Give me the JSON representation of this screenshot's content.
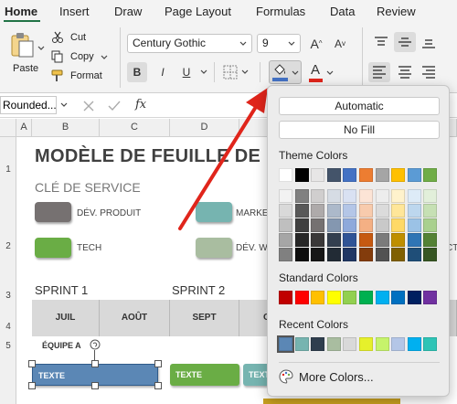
{
  "ribbon_tabs": [
    "Home",
    "Insert",
    "Draw",
    "Page Layout",
    "Formulas",
    "Data",
    "Review"
  ],
  "clipboard": {
    "paste_label": "Paste",
    "cut_label": "Cut",
    "copy_label": "Copy",
    "format_label": "Format"
  },
  "font": {
    "name": "Century Gothic",
    "size": "9",
    "bold": "B",
    "italic": "I",
    "underline": "U",
    "font_color_glyph": "A"
  },
  "formula_bar": {
    "name_box": "Rounded...",
    "fx": "fx"
  },
  "columns": [
    "A",
    "B",
    "C",
    "D"
  ],
  "rows": [
    "1",
    "2",
    "3",
    "4",
    "5"
  ],
  "sheet": {
    "title": "MODÈLE DE FEUILLE DE RO",
    "subtitle": "CLÉ DE SERVICE",
    "legend": [
      {
        "label": "DÉV. PRODUIT",
        "color": "#767171"
      },
      {
        "label": "MARKE",
        "color": "#76b4b0"
      },
      {
        "label": "TECH",
        "color": "#6aad45"
      },
      {
        "label": "DÉV. W",
        "color": "#a9bda0"
      }
    ],
    "legend_cut": "CT",
    "sprints": [
      "SPRINT 1",
      "SPRINT 2"
    ],
    "months": [
      "JUIL",
      "AOÛT",
      "SEPT",
      "O"
    ],
    "team_label": "ÉQUIPE A",
    "tasks": [
      {
        "label": "TEXTE",
        "color": "#5b87b5"
      },
      {
        "label": "TEXTE",
        "color": "#6aad45"
      },
      {
        "label": "TEXTE",
        "color": "#76b4b0"
      }
    ]
  },
  "fill_menu": {
    "automatic_label": "Automatic",
    "no_fill_label": "No Fill",
    "theme_header": "Theme Colors",
    "theme_base": [
      "#ffffff",
      "#000000",
      "#e7e6e6",
      "#44546a",
      "#4472c4",
      "#ed7d31",
      "#a5a5a5",
      "#ffc000",
      "#5b9bd5",
      "#70ad47"
    ],
    "theme_shades": [
      [
        "#f2f2f2",
        "#808080",
        "#d0cece",
        "#d6dce4",
        "#d9e1f2",
        "#fce4d6",
        "#ededed",
        "#fff2cc",
        "#ddebf7",
        "#e2efda"
      ],
      [
        "#d9d9d9",
        "#595959",
        "#aeaaaa",
        "#acb9ca",
        "#b4c6e7",
        "#f8cbad",
        "#dbdbdb",
        "#ffe699",
        "#bdd7ee",
        "#c6e0b4"
      ],
      [
        "#bfbfbf",
        "#404040",
        "#757171",
        "#8497b0",
        "#8ea9db",
        "#f4b084",
        "#c9c9c9",
        "#ffd966",
        "#9bc2e6",
        "#a9d08e"
      ],
      [
        "#a6a6a6",
        "#262626",
        "#3a3838",
        "#333f4f",
        "#305496",
        "#c65911",
        "#7b7b7b",
        "#bf8f00",
        "#2f75b5",
        "#548235"
      ],
      [
        "#808080",
        "#0d0d0d",
        "#161616",
        "#222b35",
        "#203764",
        "#833c0c",
        "#525252",
        "#806000",
        "#1f4e78",
        "#375623"
      ]
    ],
    "standard_header": "Standard Colors",
    "standard": [
      "#c00000",
      "#ff0000",
      "#ffc000",
      "#ffff00",
      "#92d050",
      "#00b050",
      "#00b0f0",
      "#0070c0",
      "#002060",
      "#7030a0"
    ],
    "recent_header": "Recent Colors",
    "recent": [
      "#5b87b5",
      "#76b4b0",
      "#2f3e4e",
      "#a9bda0",
      "#d9d9d9",
      "#e6f02b",
      "#c6f36b",
      "#b4c6e7",
      "#00b0f0",
      "#2ec4b6"
    ],
    "more_label": "More Colors..."
  },
  "colors": {
    "accent": "#217346",
    "arrow": "#e0251b",
    "fill_bar": "#4472c4",
    "font_bar": "#e0251b"
  },
  "icons": [
    "paste-icon",
    "scissors-icon",
    "copy-icon",
    "format-painter-icon",
    "paint-bucket-icon",
    "borders-icon",
    "grow-font-icon",
    "shrink-font-icon",
    "align-icons",
    "cancel-icon",
    "confirm-icon",
    "palette-icon"
  ]
}
